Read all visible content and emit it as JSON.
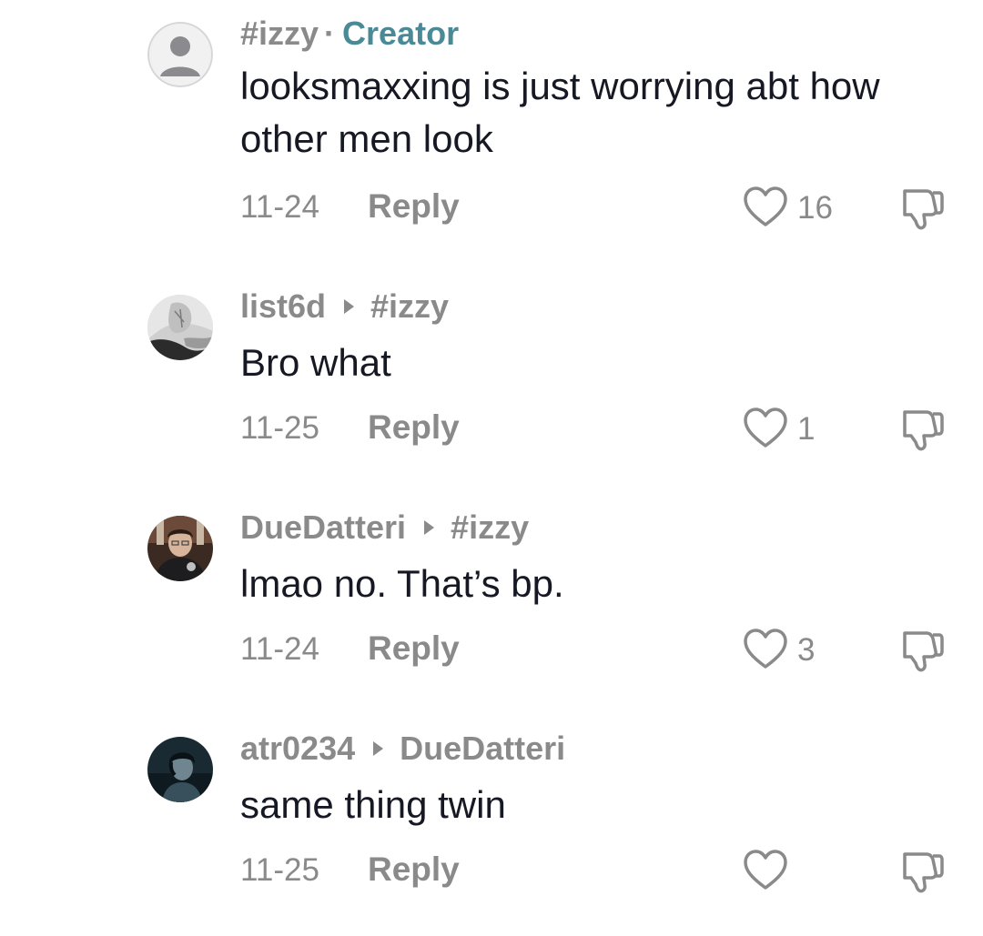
{
  "comments": [
    {
      "username": "#izzy",
      "badge": "Creator",
      "text": "looksmaxxing is just worrying abt how other men look",
      "date": "11-24",
      "reply_label": "Reply",
      "likes": "16"
    },
    {
      "username": "list6d",
      "reply_to": "#izzy",
      "text": "Bro what",
      "date": "11-25",
      "reply_label": "Reply",
      "likes": "1"
    },
    {
      "username": "DueDatteri",
      "reply_to": "#izzy",
      "text": "lmao no. That’s bp.",
      "date": "11-24",
      "reply_label": "Reply",
      "likes": "3"
    },
    {
      "username": "atr0234",
      "reply_to": "DueDatteri",
      "text": "same thing twin",
      "date": "11-25",
      "reply_label": "Reply",
      "likes": ""
    }
  ],
  "colors": {
    "text": "#161823",
    "muted": "#8a8a8a",
    "creator_badge": "#4a8a96"
  }
}
